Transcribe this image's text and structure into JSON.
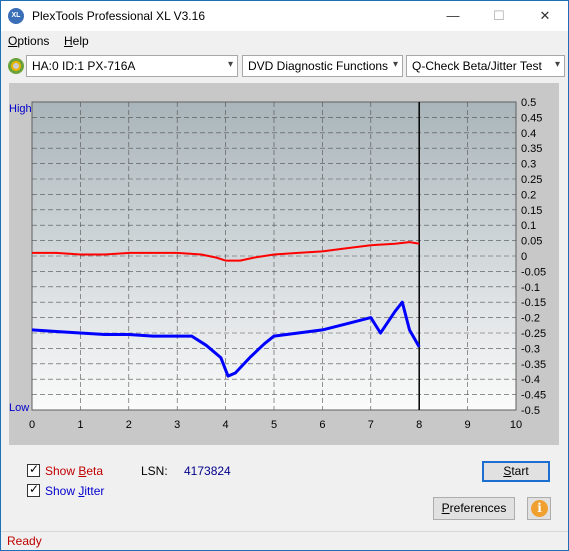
{
  "window": {
    "title": "PlexTools Professional XL V3.16",
    "app_icon_text": "XL",
    "minimize_glyph": "—",
    "maximize_glyph": "☐",
    "close_glyph": "✕"
  },
  "menu": {
    "options_first": "O",
    "options_rest": "ptions",
    "help_first": "H",
    "help_rest": "elp"
  },
  "toolbar": {
    "drive": "HA:0 ID:1  PX-716A",
    "function": "DVD Diagnostic Functions",
    "test": "Q-Check Beta/Jitter Test",
    "arrow_glyph": "▾"
  },
  "chart_data": {
    "type": "line",
    "left_axis_top_label": "High",
    "left_axis_bottom_label": "Low",
    "x_ticks": [
      "0",
      "1",
      "2",
      "3",
      "4",
      "5",
      "6",
      "7",
      "8",
      "9",
      "10"
    ],
    "y_ticks": [
      "0.5",
      "0.45",
      "0.4",
      "0.35",
      "0.3",
      "0.25",
      "0.2",
      "0.15",
      "0.1",
      "0.05",
      "0",
      "-0.05",
      "-0.1",
      "-0.15",
      "-0.2",
      "-0.25",
      "-0.3",
      "-0.35",
      "-0.4",
      "-0.45",
      "-0.5"
    ],
    "xlim": [
      0,
      10
    ],
    "ylim": [
      -0.5,
      0.5
    ],
    "grid": true,
    "end_marker_x": 8.0,
    "series": [
      {
        "color": "#ff0000",
        "x": [
          0,
          0.5,
          1,
          1.5,
          2,
          2.5,
          3,
          3.5,
          3.8,
          4.0,
          4.3,
          4.6,
          5,
          5.5,
          6,
          6.5,
          7,
          7.5,
          7.8,
          8.0
        ],
        "y": [
          0.01,
          0.01,
          0.005,
          0.005,
          0.01,
          0.01,
          0.01,
          0.005,
          -0.005,
          -0.015,
          -0.015,
          -0.005,
          0.005,
          0.01,
          0.015,
          0.025,
          0.035,
          0.04,
          0.045,
          0.04
        ]
      },
      {
        "color": "#0000ff",
        "x": [
          0,
          0.5,
          1,
          1.5,
          2,
          2.5,
          3,
          3.3,
          3.6,
          3.9,
          4.05,
          4.2,
          4.5,
          4.8,
          5,
          5.5,
          6,
          6.5,
          7,
          7.2,
          7.5,
          7.65,
          7.8,
          8.0
        ],
        "y": [
          -0.24,
          -0.245,
          -0.25,
          -0.255,
          -0.255,
          -0.26,
          -0.26,
          -0.26,
          -0.29,
          -0.33,
          -0.39,
          -0.38,
          -0.33,
          -0.285,
          -0.26,
          -0.25,
          -0.24,
          -0.22,
          -0.2,
          -0.25,
          -0.18,
          -0.15,
          -0.24,
          -0.295
        ]
      }
    ]
  },
  "bottom": {
    "show_beta_first": "Show ",
    "show_beta_u": "B",
    "show_beta_rest": "eta",
    "show_jitter_first": "Show ",
    "show_jitter_u": "J",
    "show_jitter_rest": "itter",
    "check_glyph": "✓",
    "lsn_label": "LSN:",
    "lsn_value": "4173824",
    "start_first": "S",
    "start_rest": "tart",
    "prefs_first": "P",
    "prefs_rest": "references",
    "info_glyph": "i"
  },
  "status": {
    "text": "Ready"
  },
  "colors": {
    "beta": "#ff0000",
    "jitter": "#0000ff",
    "status": "#c00000",
    "lsn_value": "#00008b",
    "label_blue": "#0000cc",
    "info_button": "#f0a030"
  }
}
